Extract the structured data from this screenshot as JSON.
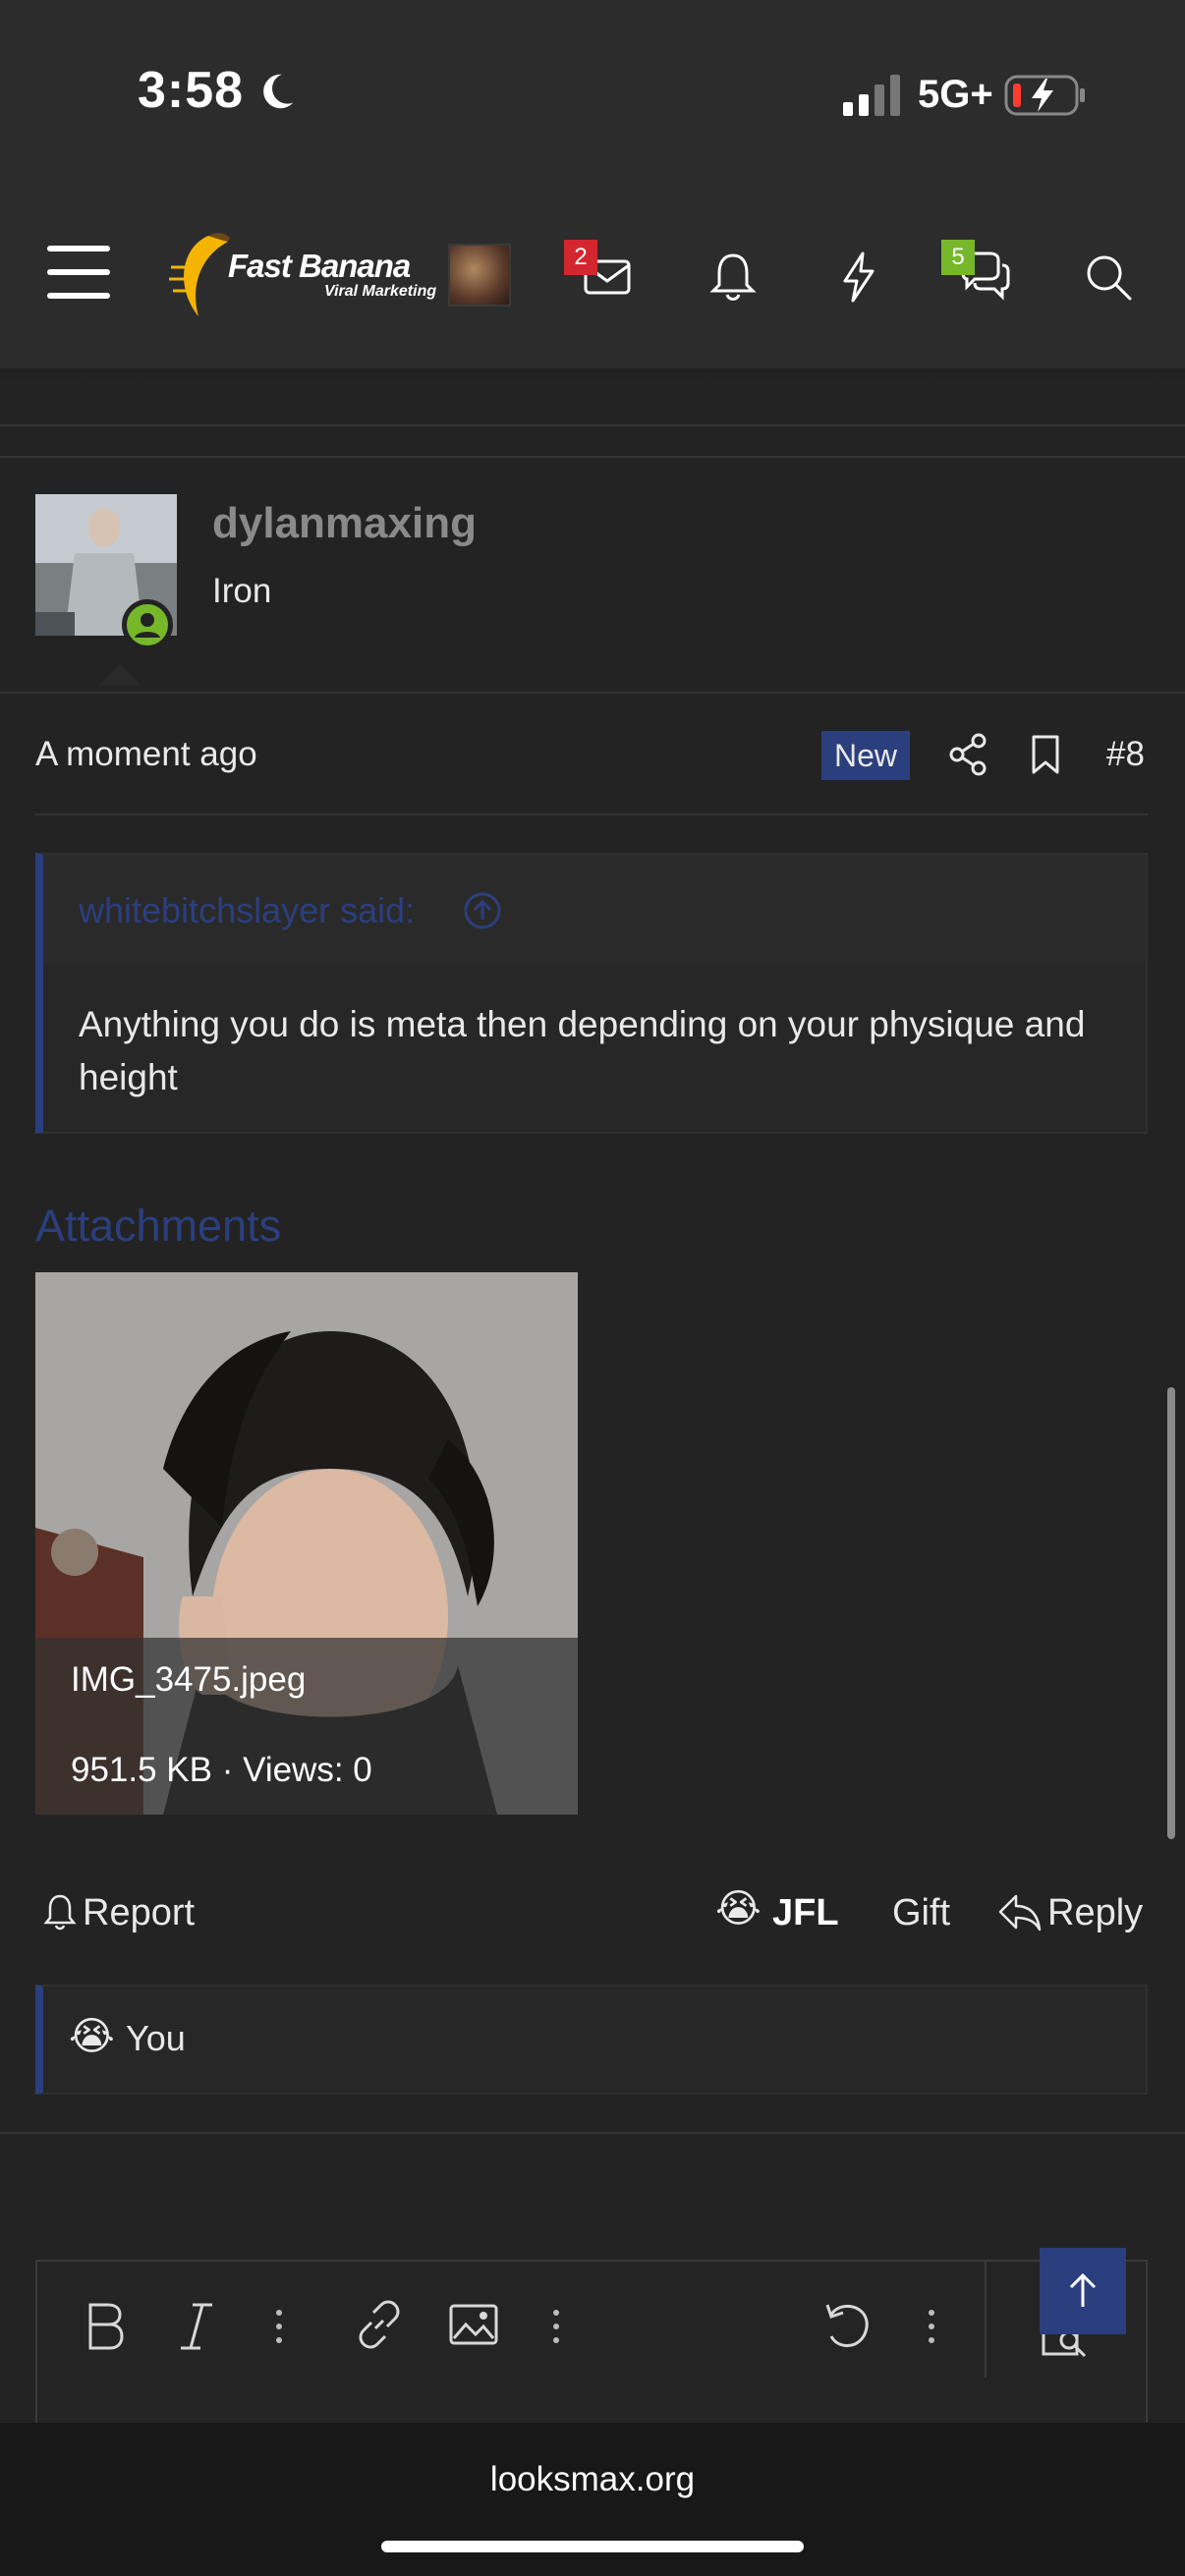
{
  "status_bar": {
    "time": "3:58",
    "network": "5G+"
  },
  "header": {
    "logo_brand": "Fast Banana",
    "logo_sub": "Viral Marketing",
    "mail_count": "2",
    "chat_count": "5"
  },
  "post": {
    "username": "dylanmaxing",
    "user_title": "Iron",
    "time": "A moment ago",
    "new_badge": "New",
    "post_number": "#8",
    "quote": {
      "author": "whitebitchslayer said:",
      "text": "Anything you do is meta then depending on your physique and height"
    },
    "attachments": {
      "title": "Attachments",
      "file_name": "IMG_3475.jpeg",
      "file_meta": "951.5 KB · Views: 0"
    },
    "actions": {
      "report": "Report",
      "reaction": "JFL",
      "gift": "Gift",
      "reply": "Reply"
    },
    "reactions_summary": "You"
  },
  "footer": {
    "url": "looksmax.org"
  },
  "colors": {
    "accent": "#2b3f7e",
    "online": "#76b82a",
    "badge_red": "#d4262e",
    "background": "#232323"
  }
}
